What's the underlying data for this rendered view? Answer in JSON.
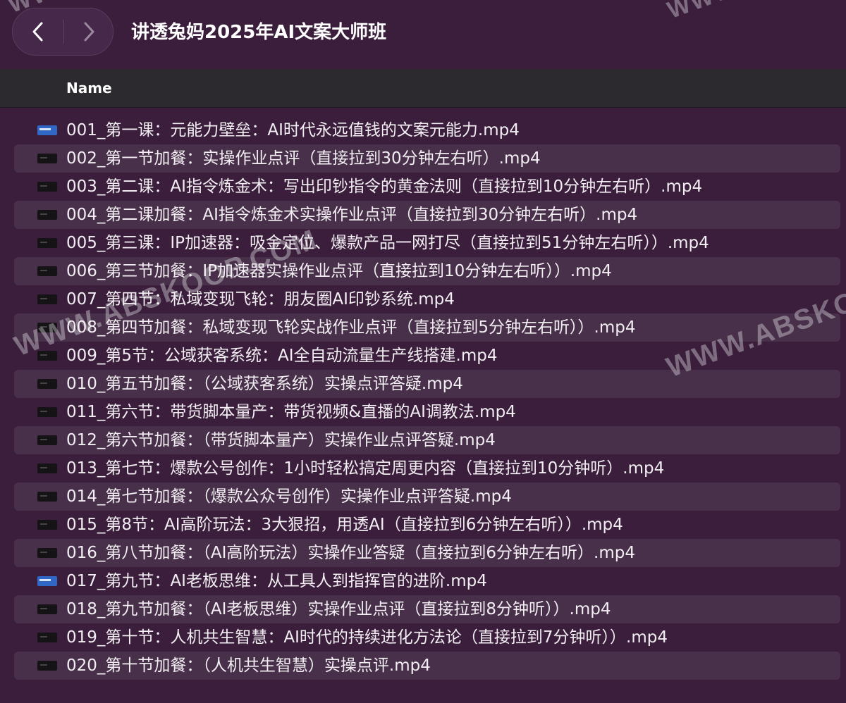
{
  "window": {
    "title": "讲透兔妈2025年AI文案大师班"
  },
  "navigation": {
    "back_icon": "chevron-left-icon",
    "forward_icon": "chevron-right-icon"
  },
  "list_header": {
    "name": "Name"
  },
  "files": [
    {
      "name": "001_第一课：元能力壁垒：AI时代永远值钱的文案元能力.mp4",
      "icon": "video-thumbnail-blue"
    },
    {
      "name": "002_第一节加餐：实操作业点评（直接拉到30分钟左右听）.mp4",
      "icon": "video-thumbnail-dark"
    },
    {
      "name": "003_第二课：AI指令炼金术：写出印钞指令的黄金法则（直接拉到10分钟左右听）.mp4",
      "icon": "video-thumbnail-dark"
    },
    {
      "name": "004_第二课加餐：AI指令炼金术实操作业点评（直接拉到30分钟左右听）.mp4",
      "icon": "video-thumbnail-dark"
    },
    {
      "name": "005_第三课：IP加速器：吸金定位、爆款产品一网打尽（直接拉到51分钟左右听））.mp4",
      "icon": "video-thumbnail-dark"
    },
    {
      "name": "006_第三节加餐：IP加速器实操作业点评（直接拉到10分钟左右听））.mp4",
      "icon": "video-thumbnail-dark"
    },
    {
      "name": "007_第四节：私域变现飞轮：朋友圈AI印钞系统.mp4",
      "icon": "video-thumbnail-dark"
    },
    {
      "name": "008_第四节加餐：私域变现飞轮实战作业点评（直接拉到5分钟左右听））.mp4",
      "icon": "video-thumbnail-dark"
    },
    {
      "name": "009_第5节：公域获客系统：AI全自动流量生产线搭建.mp4",
      "icon": "video-thumbnail-dark"
    },
    {
      "name": "010_第五节加餐：（公域获客系统）实操点评答疑.mp4",
      "icon": "video-thumbnail-dark"
    },
    {
      "name": "011_第六节：带货脚本量产：带货视频&直播的AI调教法.mp4",
      "icon": "video-thumbnail-dark"
    },
    {
      "name": "012_第六节加餐：（带货脚本量产）实操作业点评答疑.mp4",
      "icon": "video-thumbnail-dark"
    },
    {
      "name": "013_第七节：爆款公号创作：1小时轻松搞定周更内容（直接拉到10分钟听）.mp4",
      "icon": "video-thumbnail-dark"
    },
    {
      "name": "014_第七节加餐：（爆款公众号创作）实操作业点评答疑.mp4",
      "icon": "video-thumbnail-dark"
    },
    {
      "name": "015_第8节：AI高阶玩法：3大狠招，用透AI（直接拉到6分钟左右听））.mp4",
      "icon": "video-thumbnail-dark"
    },
    {
      "name": "016_第八节加餐：（AI高阶玩法）实操作业答疑（直接拉到6分钟左右听）.mp4",
      "icon": "video-thumbnail-dark"
    },
    {
      "name": "017_第九节：AI老板思维：从工具人到指挥官的进阶.mp4",
      "icon": "video-thumbnail-blue"
    },
    {
      "name": "018_第九节加餐：（AI老板思维）实操作业点评（直接拉到8分钟听））.mp4",
      "icon": "video-thumbnail-dark"
    },
    {
      "name": "019_第十节：人机共生智慧：AI时代的持续进化方法论（直接拉到7分钟听））.mp4",
      "icon": "video-thumbnail-dark"
    },
    {
      "name": "020_第十节加餐：（人机共生智慧）实操点评.mp4",
      "icon": "video-thumbnail-dark"
    }
  ],
  "watermarks": {
    "text_1": "WWW.ABSKOOP.COM",
    "text_2": "WWW.ABSKOOP.COM",
    "text_3": "WWW.ABSKO",
    "text_4": "WWW.",
    "text_5": "WWW."
  },
  "colors": {
    "background": "#3a1e3c",
    "row_alt": "#48304b",
    "header": "#2c2a2e",
    "text": "#f2eef2"
  }
}
